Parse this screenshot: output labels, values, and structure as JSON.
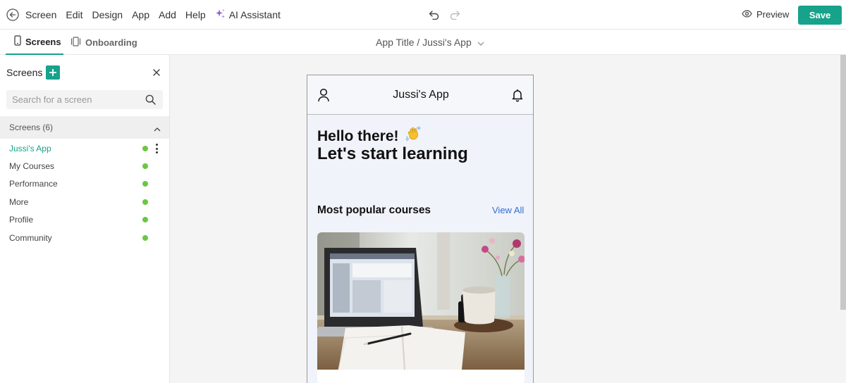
{
  "menu": {
    "items": [
      "Screen",
      "Edit",
      "Design",
      "App",
      "Add",
      "Help"
    ],
    "ai_assistant": "AI Assistant",
    "preview": "Preview",
    "save": "Save"
  },
  "tabs": {
    "screens": "Screens",
    "onboarding": "Onboarding"
  },
  "breadcrumb": "App Title / Jussi's App",
  "sidebar": {
    "title": "Screens",
    "search_placeholder": "Search for a screen",
    "group_label": "Screens (6)",
    "screens": [
      "Jussi's App",
      "My Courses",
      "Performance",
      "More",
      "Profile",
      "Community"
    ]
  },
  "phone": {
    "title": "Jussi's App",
    "greeting": "Hello there!",
    "greeting_emoji": "👋",
    "headline": "Let's start learning",
    "section_title": "Most popular courses",
    "view_all": "View All"
  },
  "colors": {
    "accent": "#17a28b",
    "status_ok": "#6cc644",
    "link": "#2f6fd6"
  }
}
